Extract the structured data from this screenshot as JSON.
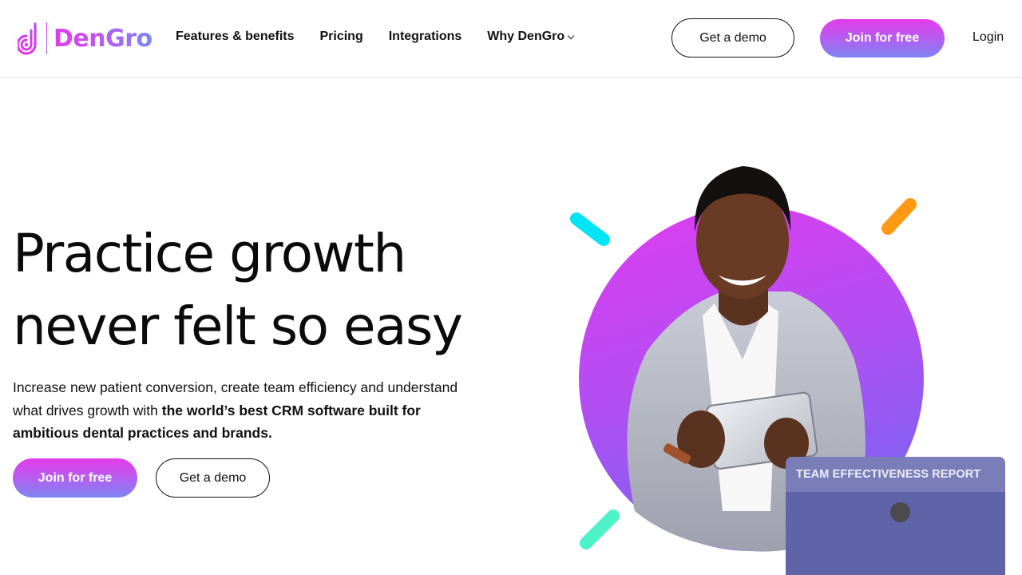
{
  "brand": {
    "name": "DenGro",
    "accent_start": "#e43bea",
    "accent_end": "#7d86f3"
  },
  "nav": {
    "items": [
      {
        "label": "Features & benefits",
        "has_dropdown": false
      },
      {
        "label": "Pricing",
        "has_dropdown": false
      },
      {
        "label": "Integrations",
        "has_dropdown": false
      },
      {
        "label": "Why DenGro",
        "has_dropdown": true
      }
    ],
    "demo_label": "Get a demo",
    "join_label": "Join for free",
    "login_label": "Login"
  },
  "hero": {
    "title_line1": "Practice growth",
    "title_line2": "never felt so easy",
    "subtitle_plain": "Increase new patient conversion, create team efficiency and understand what drives growth with ",
    "subtitle_bold": "the world’s best CRM software built for ambitious dental practices and brands.",
    "join_label": "Join for free",
    "demo_label": "Get a demo"
  },
  "visual": {
    "circle_color_top": "#d93cf0",
    "circle_color_bottom": "#8a5cf2",
    "accent_cyan": "#00e5f5",
    "accent_orange": "#ff9a14",
    "accent_mint": "#4ef2c9"
  },
  "report_card": {
    "title": "TEAM EFFECTIVENESS REPORT"
  }
}
